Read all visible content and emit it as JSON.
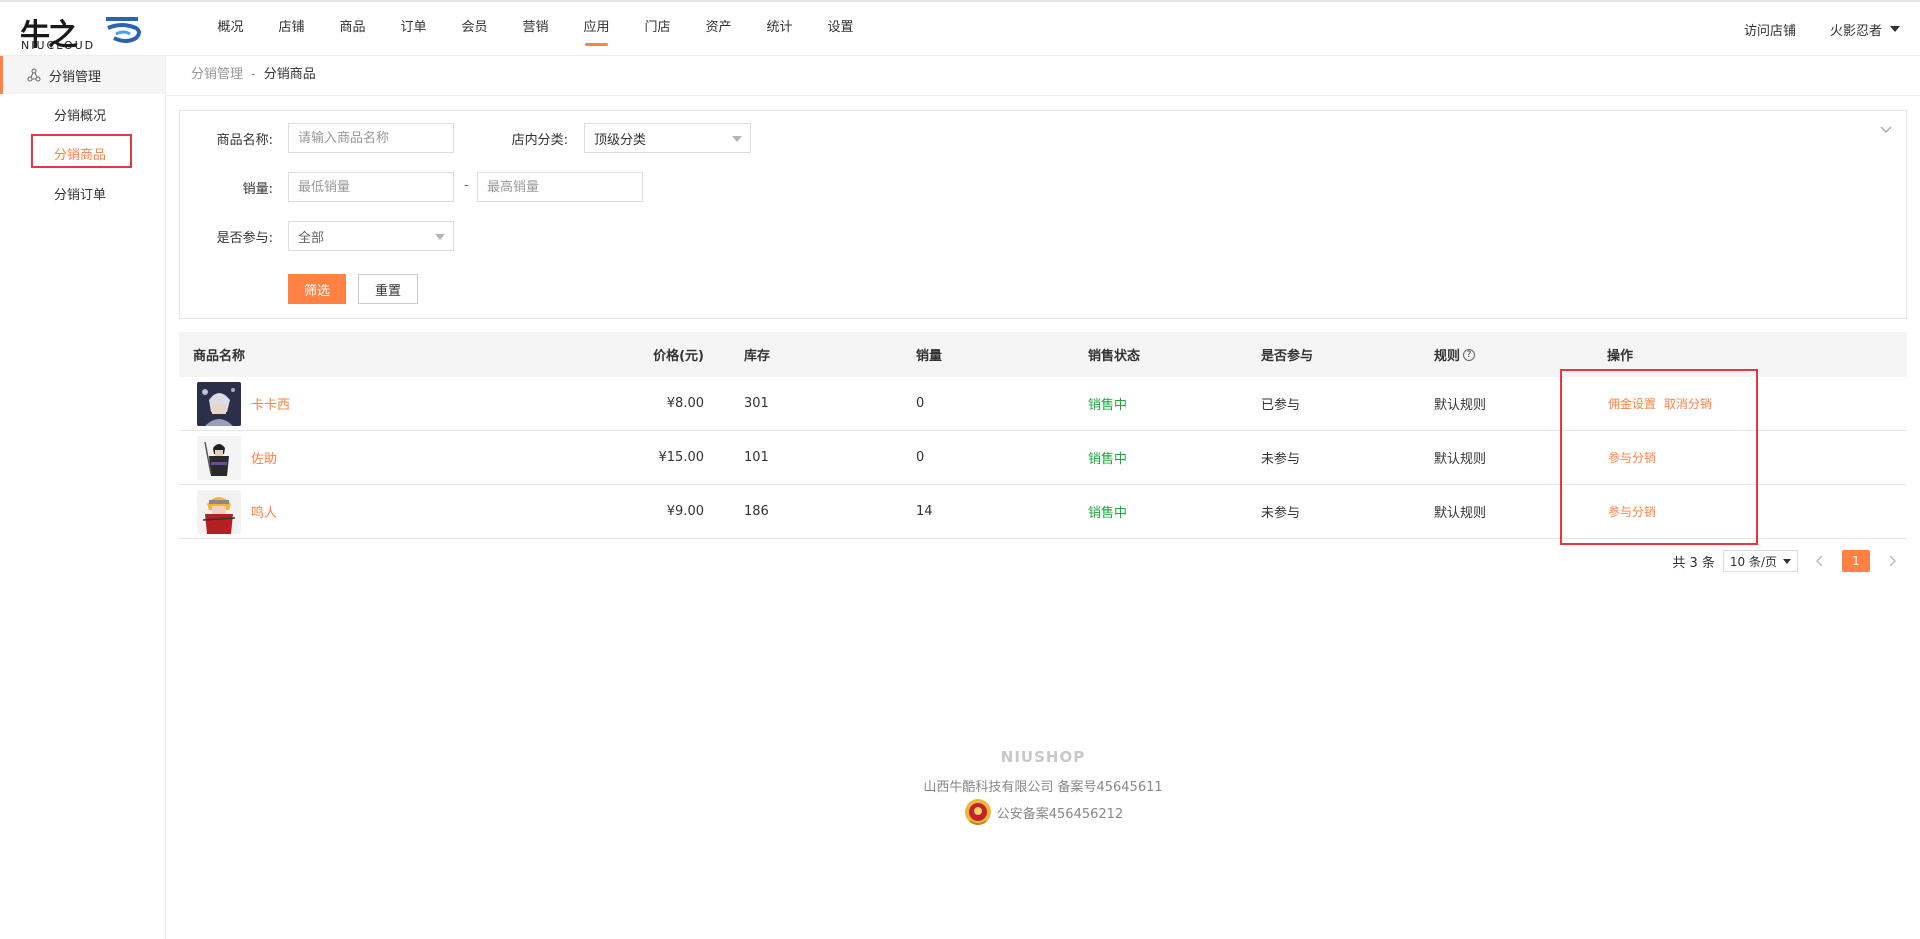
{
  "logo": {
    "cn": "牛之",
    "en": "NIUCLOUD"
  },
  "nav": [
    {
      "label": "概况"
    },
    {
      "label": "店铺"
    },
    {
      "label": "商品"
    },
    {
      "label": "订单"
    },
    {
      "label": "会员"
    },
    {
      "label": "营销"
    },
    {
      "label": "应用",
      "active": true
    },
    {
      "label": "门店"
    },
    {
      "label": "资产"
    },
    {
      "label": "统计"
    },
    {
      "label": "设置"
    }
  ],
  "header": {
    "visit_store": "访问店铺",
    "user": "火影忍者"
  },
  "sidebar": {
    "group": "分销管理",
    "items": [
      {
        "label": "分销概况"
      },
      {
        "label": "分销商品",
        "active": true
      },
      {
        "label": "分销订单"
      }
    ]
  },
  "breadcrumb": {
    "parent": "分销管理",
    "sep": "-",
    "current": "分销商品"
  },
  "filter": {
    "name_label": "商品名称:",
    "name_placeholder": "请输入商品名称",
    "category_label": "店内分类:",
    "category_value": "顶级分类",
    "sales_label": "销量:",
    "sales_min_placeholder": "最低销量",
    "sales_sep": "-",
    "sales_max_placeholder": "最高销量",
    "join_label": "是否参与:",
    "join_value": "全部",
    "submit": "筛选",
    "reset": "重置"
  },
  "table": {
    "headers": {
      "name": "商品名称",
      "price": "价格(元)",
      "stock": "库存",
      "sales": "销量",
      "status": "销售状态",
      "joined": "是否参与",
      "rule": "规则",
      "action": "操作"
    },
    "rows": [
      {
        "name": "卡卡西",
        "price": "¥8.00",
        "stock": "301",
        "sales": "0",
        "status": "销售中",
        "joined": "已参与",
        "rule": "默认规则",
        "actions": [
          "佣金设置",
          "取消分销"
        ]
      },
      {
        "name": "佐助",
        "price": "¥15.00",
        "stock": "101",
        "sales": "0",
        "status": "销售中",
        "joined": "未参与",
        "rule": "默认规则",
        "actions": [
          "参与分销"
        ]
      },
      {
        "name": "鸣人",
        "price": "¥9.00",
        "stock": "186",
        "sales": "14",
        "status": "销售中",
        "joined": "未参与",
        "rule": "默认规则",
        "actions": [
          "参与分销"
        ]
      }
    ]
  },
  "pager": {
    "total": "共 3 条",
    "page_size": "10 条/页",
    "current": "1"
  },
  "footer": {
    "brand": "NIUSHOP",
    "company": "山西牛酷科技有限公司  备案号45645611",
    "police": "公安备案456456212"
  },
  "colors": {
    "accent": "#ff8143",
    "status_green": "#20a53a",
    "highlight_red": "#e8383d"
  }
}
